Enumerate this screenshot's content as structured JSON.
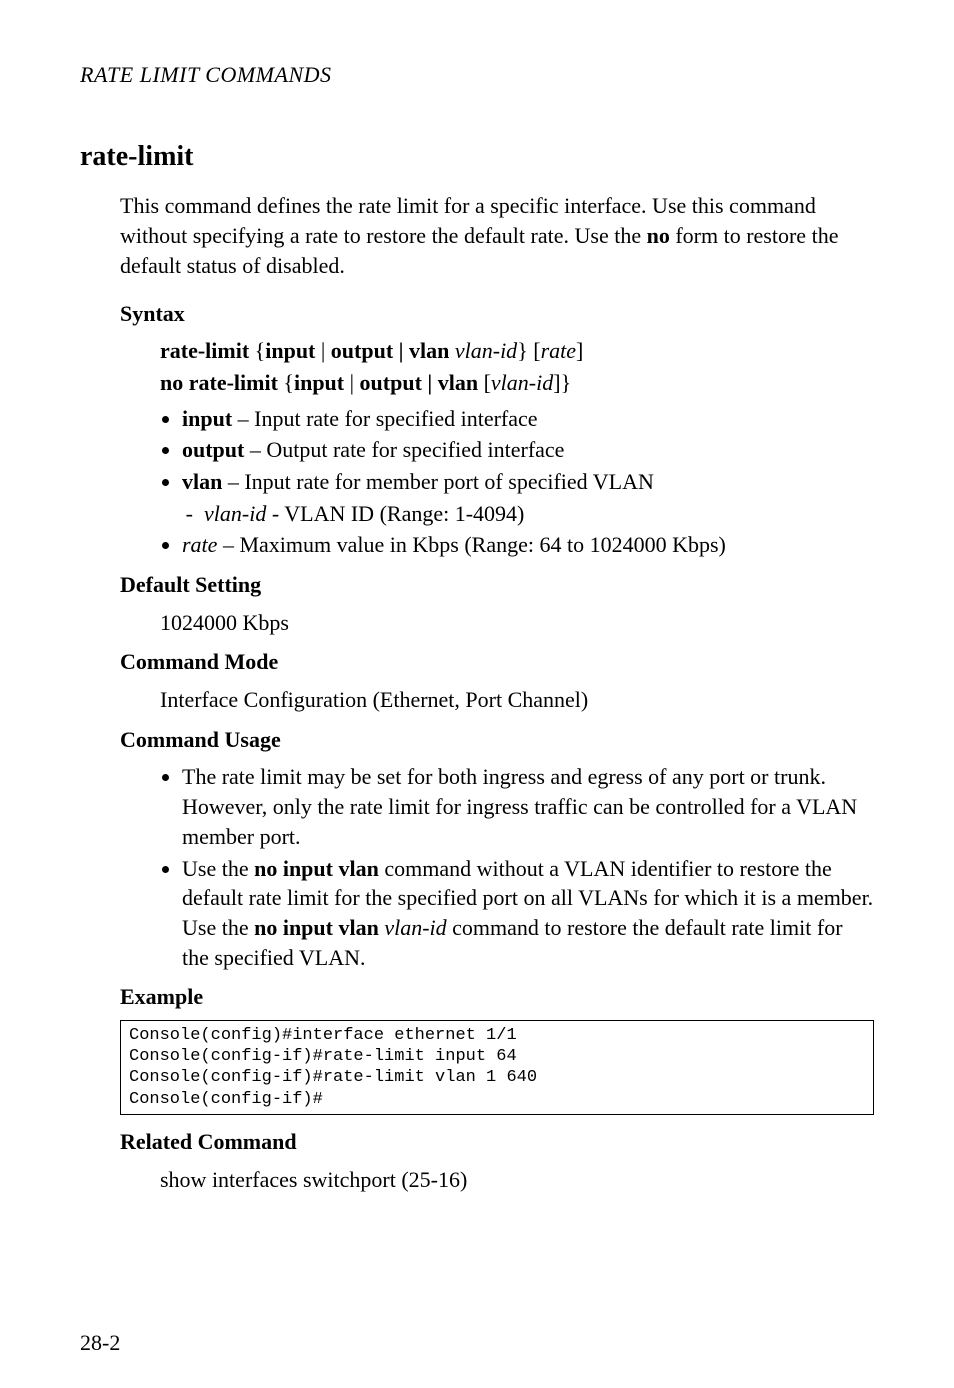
{
  "running_head": "RATE LIMIT COMMANDS",
  "cmd_name": "rate-limit",
  "intro_prefix": "This command defines the rate limit for a specific interface. Use this command without specifying a rate to restore the default rate. Use the ",
  "intro_bold": "no",
  "intro_suffix": " form to restore the default status of disabled.",
  "syntax": {
    "label": "Syntax",
    "line1": {
      "a": "rate-limit",
      "b": " {",
      "c": "input",
      "d": " | ",
      "e": "output | vlan ",
      "f": "vlan-id",
      "g": "} [",
      "h": "rate",
      "i": "]"
    },
    "line2": {
      "a": "no rate-limit",
      "b": " {",
      "c": "input",
      "d": " | ",
      "e": "output | vlan",
      "f": " [",
      "g": "vlan-id",
      "h": "]}"
    },
    "bullets": {
      "input": {
        "kw": "input",
        "txt": " – Input rate for specified interface"
      },
      "output": {
        "kw": "output",
        "txt": " – Output rate for specified interface"
      },
      "vlan": {
        "kw": "vlan",
        "txt": " – Input rate for member port of specified VLAN"
      },
      "vlan_sub": {
        "kw": "vlan-id",
        "txt": " - VLAN ID (Range: 1-4094)"
      },
      "rate": {
        "kw": "rate",
        "txt": " – Maximum value in Kbps (Range: 64 to 1024000 Kbps)"
      }
    }
  },
  "default_setting": {
    "label": "Default Setting",
    "value": "1024000 Kbps"
  },
  "command_mode": {
    "label": "Command Mode",
    "value": "Interface Configuration (Ethernet, Port Channel)"
  },
  "command_usage": {
    "label": "Command Usage",
    "item1": "The rate limit may be set for both ingress and egress of any port or trunk. However, only the rate limit for ingress traffic can be controlled for a VLAN member port.",
    "item2": {
      "a": "Use the ",
      "b": "no input vlan",
      "c": " command without a VLAN identifier to restore the default rate limit for the specified port on all VLANs for which it is a member. Use the ",
      "d": "no input vlan ",
      "e": "vlan-id",
      "f": " command to restore the default rate limit for the specified VLAN."
    }
  },
  "example": {
    "label": "Example",
    "code": "Console(config)#interface ethernet 1/1\nConsole(config-if)#rate-limit input 64\nConsole(config-if)#rate-limit vlan 1 640\nConsole(config-if)#"
  },
  "related": {
    "label": "Related Command",
    "value": "show interfaces switchport (25-16)"
  },
  "page_num": "28-2"
}
